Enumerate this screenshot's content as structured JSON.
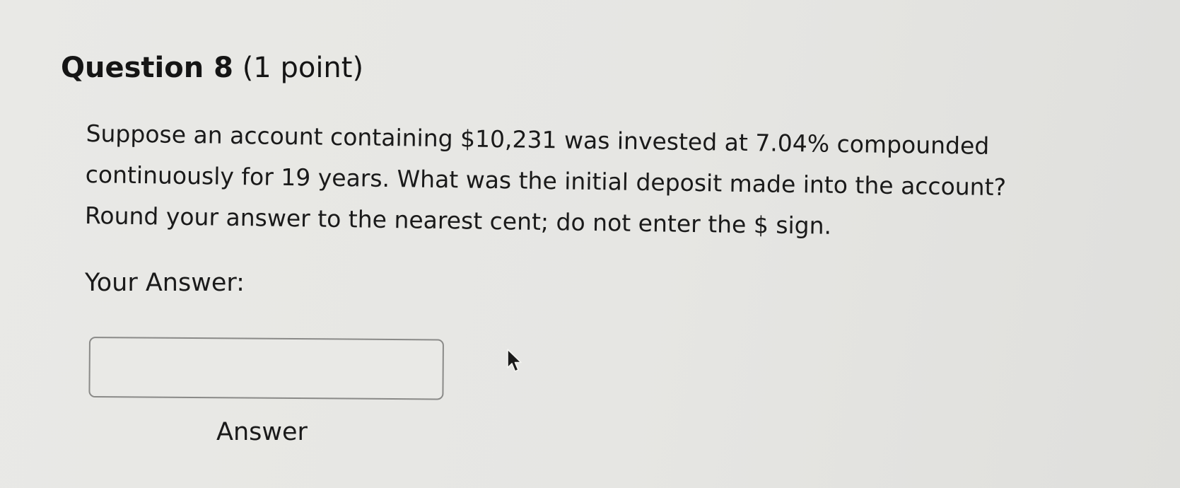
{
  "question": {
    "number_label": "Question 8",
    "points_label": "(1 point)",
    "lines": [
      "Suppose an account containing $10,231 was invested at 7.04% compounded",
      "continuously for 19 years. What was the initial deposit made into the account?",
      "Round your answer to the nearest cent; do not enter the $ sign."
    ]
  },
  "answer": {
    "label": "Your Answer:",
    "value": "",
    "placeholder": "",
    "caption": "Answer"
  },
  "cursor": {
    "icon": "arrow-pointer-icon"
  }
}
